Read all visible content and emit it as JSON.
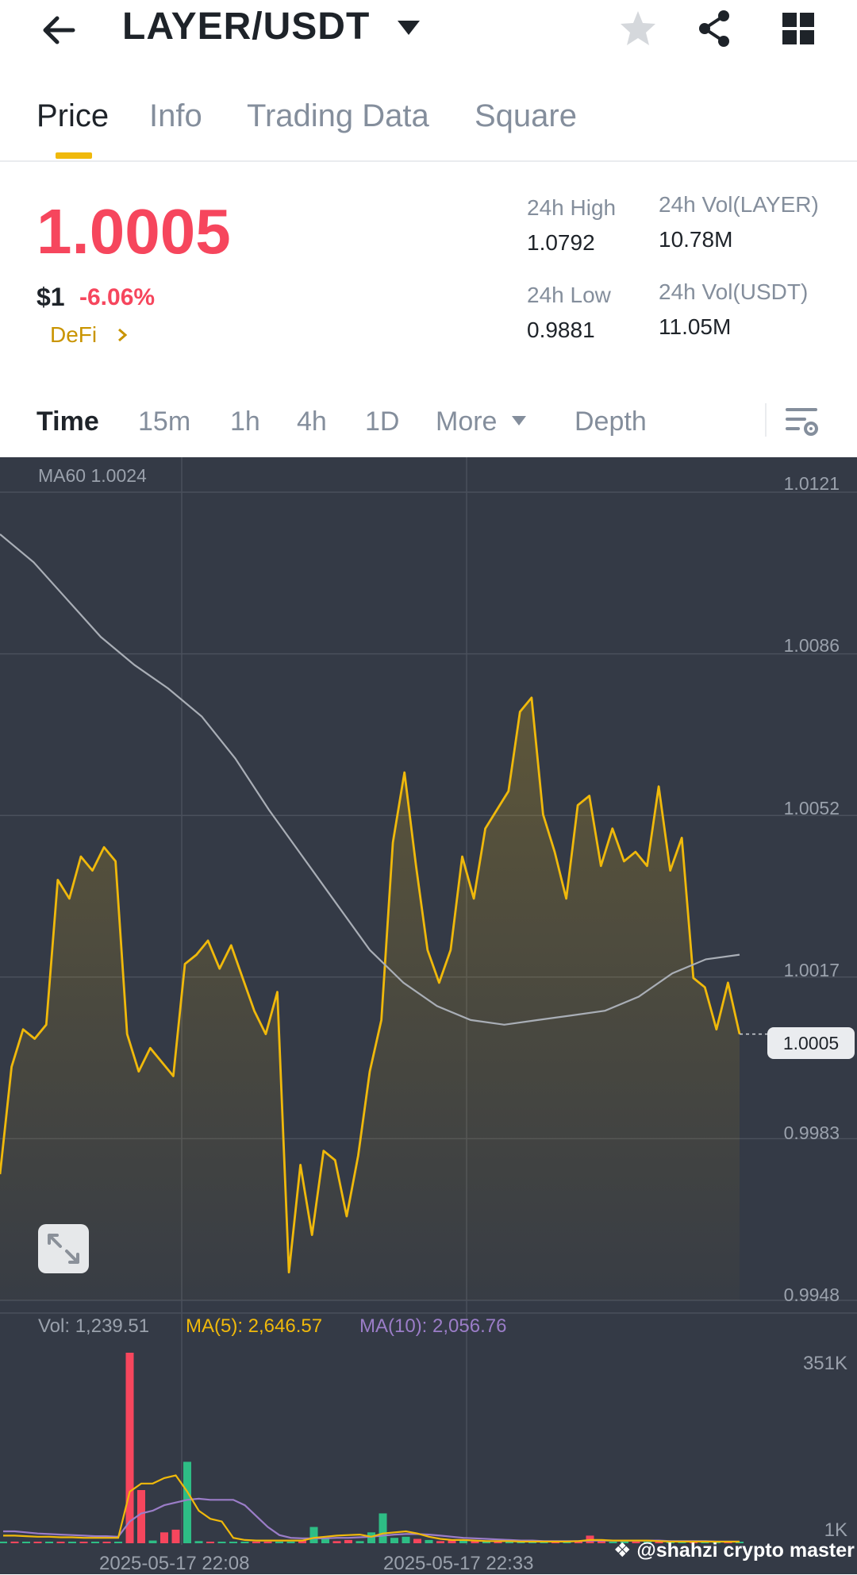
{
  "header": {
    "pair": "LAYER/USDT",
    "icons": [
      "back-arrow-icon",
      "dropdown-caret-icon",
      "star-icon",
      "share-icon",
      "grid-menu-icon"
    ]
  },
  "tabs": [
    {
      "label": "Price",
      "active": true
    },
    {
      "label": "Info",
      "active": false
    },
    {
      "label": "Trading Data",
      "active": false
    },
    {
      "label": "Square",
      "active": false
    }
  ],
  "ticker": {
    "last_price": "1.0005",
    "fiat_price": "$1",
    "change_pct": "-6.06%",
    "tag": "DeFi",
    "high_label": "24h High",
    "high_value": "1.0792",
    "low_label": "24h Low",
    "low_value": "0.9881",
    "vol_base_label": "24h Vol(LAYER)",
    "vol_base_value": "10.78M",
    "vol_quote_label": "24h Vol(USDT)",
    "vol_quote_value": "11.05M"
  },
  "intervals": {
    "items": [
      "Time",
      "15m",
      "1h",
      "4h",
      "1D",
      "More",
      "Depth"
    ],
    "active": "Time"
  },
  "chart": {
    "ma60_label": "MA60 1.0024",
    "last_price_tag": "1.0005",
    "price_ticks": [
      "1.0121",
      "1.0086",
      "1.0052",
      "1.0017",
      "0.9983",
      "0.9948"
    ],
    "vol_label": "Vol: 1,239.51",
    "ma5_label": "MA(5): 2,646.57",
    "ma10_label": "MA(10): 2,056.76",
    "vol_ticks": [
      "351K",
      "1K"
    ],
    "time_labels": [
      "2025-05-17 22:08",
      "2025-05-17 22:33"
    ],
    "watermark": "@shahzi crypto master",
    "colors": {
      "bg": "#343a46",
      "price_line": "#f0b90b",
      "ma60": "#a9aeb6",
      "up": "#2ebd85",
      "down": "#f6465d",
      "ma5": "#f0b90b",
      "ma10": "#9b7dc8"
    }
  },
  "chart_data": {
    "type": "line",
    "title": "",
    "xlabel": "",
    "ylabel": "",
    "ylim": [
      0.9948,
      1.0121
    ],
    "x_tick_labels": [
      "2025-05-17 22:08",
      "2025-05-17 22:33"
    ],
    "y_tick_labels": [
      "1.0121",
      "1.0086",
      "1.0052",
      "1.0017",
      "0.9983",
      "0.9948"
    ],
    "series": [
      {
        "name": "",
        "values": [
          0.9975,
          0.9998,
          1.0006,
          1.0004,
          1.0007,
          1.0038,
          1.0034,
          1.0043,
          1.004,
          1.0045,
          1.0042,
          1.0005,
          0.9997,
          1.0002,
          0.9999,
          0.9996,
          1.002,
          1.0022,
          1.0025,
          1.0019,
          1.0024,
          1.0017,
          1.001,
          1.0005,
          1.0014,
          0.9954,
          0.9977,
          0.9962,
          0.998,
          0.9978,
          0.9966,
          0.9979,
          0.9997,
          1.0008,
          1.0046,
          1.0061,
          1.0041,
          1.0023,
          1.0016,
          1.0023,
          1.0043,
          1.0034,
          1.0049,
          1.0053,
          1.0057,
          1.0074,
          1.0077,
          1.0052,
          1.0044,
          1.0034,
          1.0054,
          1.0056,
          1.0041,
          1.0049,
          1.0042,
          1.0044,
          1.0041,
          1.0058,
          1.004,
          1.0047,
          1.0017,
          1.0015,
          1.0006,
          1.0016,
          1.0005
        ]
      },
      {
        "name": "MA60",
        "values": [
          1.0112,
          1.0106,
          1.0098,
          1.009,
          1.0084,
          1.0079,
          1.0073,
          1.0064,
          1.0053,
          1.0043,
          1.0033,
          1.0023,
          1.0016,
          1.0011,
          1.0008,
          1.0007,
          1.0008,
          1.0009,
          1.001,
          1.0013,
          1.0018,
          1.0021,
          1.0022
        ]
      }
    ],
    "volume": {
      "ytick_labels": [
        "351K",
        "1K"
      ],
      "colors": [
        "#2ebd85",
        "#f6465d"
      ],
      "bars": [
        {
          "v": 3,
          "d": 0
        },
        {
          "v": 3,
          "d": 1
        },
        {
          "v": 2.5,
          "d": 0
        },
        {
          "v": 2,
          "d": 1
        },
        {
          "v": 2,
          "d": 0
        },
        {
          "v": 2,
          "d": 1
        },
        {
          "v": 2,
          "d": 0
        },
        {
          "v": 2,
          "d": 1
        },
        {
          "v": 2,
          "d": 0
        },
        {
          "v": 2,
          "d": 1
        },
        {
          "v": 1.5,
          "d": 0
        },
        {
          "v": 351,
          "d": 1
        },
        {
          "v": 98,
          "d": 1
        },
        {
          "v": 5,
          "d": 0
        },
        {
          "v": 20,
          "d": 1
        },
        {
          "v": 25,
          "d": 1
        },
        {
          "v": 150,
          "d": 0
        },
        {
          "v": 4,
          "d": 0
        },
        {
          "v": 2,
          "d": 1
        },
        {
          "v": 1.5,
          "d": 0
        },
        {
          "v": 1.5,
          "d": 0
        },
        {
          "v": 1,
          "d": 0
        },
        {
          "v": 3,
          "d": 1
        },
        {
          "v": 3,
          "d": 1
        },
        {
          "v": 2,
          "d": 0
        },
        {
          "v": 3,
          "d": 0
        },
        {
          "v": 6,
          "d": 1
        },
        {
          "v": 30,
          "d": 0
        },
        {
          "v": 10,
          "d": 0
        },
        {
          "v": 4,
          "d": 1
        },
        {
          "v": 6,
          "d": 1
        },
        {
          "v": 4,
          "d": 0
        },
        {
          "v": 20,
          "d": 0
        },
        {
          "v": 55,
          "d": 0
        },
        {
          "v": 10,
          "d": 0
        },
        {
          "v": 12,
          "d": 0
        },
        {
          "v": 8,
          "d": 1
        },
        {
          "v": 6,
          "d": 0
        },
        {
          "v": 4,
          "d": 1
        },
        {
          "v": 6,
          "d": 1
        },
        {
          "v": 5,
          "d": 0
        },
        {
          "v": 4,
          "d": 1
        },
        {
          "v": 3,
          "d": 0
        },
        {
          "v": 3,
          "d": 1
        },
        {
          "v": 3,
          "d": 0
        },
        {
          "v": 2,
          "d": 0
        },
        {
          "v": 2,
          "d": 0
        },
        {
          "v": 3,
          "d": 0
        },
        {
          "v": 2,
          "d": 1
        },
        {
          "v": 2,
          "d": 0
        },
        {
          "v": 4,
          "d": 1
        },
        {
          "v": 14,
          "d": 1
        },
        {
          "v": 5,
          "d": 1
        },
        {
          "v": 2,
          "d": 0
        },
        {
          "v": 4,
          "d": 0
        },
        {
          "v": 3,
          "d": 1
        },
        {
          "v": 2,
          "d": 0
        },
        {
          "v": 2,
          "d": 1
        },
        {
          "v": 2,
          "d": 0
        },
        {
          "v": 2,
          "d": 0
        },
        {
          "v": 2,
          "d": 1
        },
        {
          "v": 2,
          "d": 0
        },
        {
          "v": 1.5,
          "d": 0
        },
        {
          "v": 1.5,
          "d": 1
        },
        {
          "v": 1.2,
          "d": 0
        }
      ],
      "ma5": [
        14,
        14,
        13,
        12,
        12,
        11,
        11,
        10,
        10,
        10,
        10,
        95,
        110,
        110,
        120,
        125,
        95,
        60,
        45,
        40,
        10,
        6,
        5,
        5,
        5,
        5,
        5,
        10,
        12,
        14,
        15,
        16,
        12,
        18,
        20,
        22,
        18,
        12,
        8,
        6,
        6,
        5,
        4,
        4,
        4,
        3,
        3,
        3,
        3,
        3,
        4,
        6,
        6,
        5,
        5,
        5,
        5,
        4,
        3,
        3,
        3,
        3,
        2,
        2,
        2
      ],
      "ma10": [
        22,
        22,
        20,
        18,
        17,
        16,
        15,
        14,
        13,
        13,
        12,
        40,
        55,
        60,
        70,
        75,
        80,
        82,
        80,
        80,
        80,
        70,
        50,
        30,
        15,
        10,
        9,
        9,
        9,
        10,
        10,
        11,
        12,
        14,
        16,
        17,
        17,
        16,
        14,
        12,
        10,
        9,
        8,
        7,
        6,
        5,
        5,
        4,
        4,
        4,
        4,
        5,
        5,
        5,
        5,
        5,
        5,
        5,
        4,
        4,
        4,
        4,
        3,
        3,
        3
      ]
    }
  }
}
